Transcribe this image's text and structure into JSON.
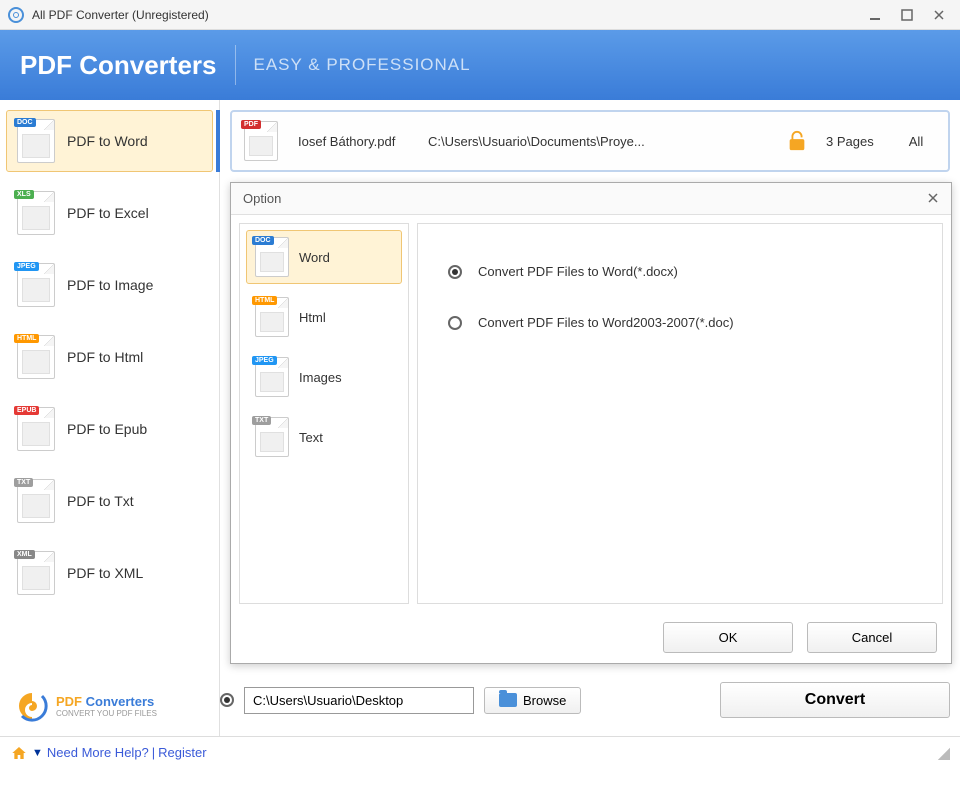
{
  "window": {
    "title": "All PDF Converter (Unregistered)"
  },
  "header": {
    "title": "PDF Converters",
    "tagline": "EASY & PROFESSIONAL"
  },
  "sidebar": {
    "items": [
      {
        "label": "PDF to Word",
        "badge": "DOC"
      },
      {
        "label": "PDF to Excel",
        "badge": "XLS"
      },
      {
        "label": "PDF to Image",
        "badge": "JPEG"
      },
      {
        "label": "PDF to Html",
        "badge": "HTML"
      },
      {
        "label": "PDF to Epub",
        "badge": "EPUB"
      },
      {
        "label": "PDF to Txt",
        "badge": "TXT"
      },
      {
        "label": "PDF to XML",
        "badge": "XML"
      }
    ]
  },
  "file": {
    "name": "Iosef Báthory.pdf",
    "path": "C:\\Users\\Usuario\\Documents\\Proye...",
    "pages": "3 Pages",
    "range": "All",
    "badge": "PDF"
  },
  "output": {
    "path": "C:\\Users\\Usuario\\Desktop",
    "browse_label": "Browse",
    "convert_label": "Convert"
  },
  "logo": {
    "pdf": "PDF",
    "conv": " Converters",
    "sub": "CONVERT YOU PDF FILES"
  },
  "modal": {
    "title": "Option",
    "tabs": [
      {
        "label": "Word",
        "badge": "DOC"
      },
      {
        "label": "Html",
        "badge": "HTML"
      },
      {
        "label": "Images",
        "badge": "JPEG"
      },
      {
        "label": "Text",
        "badge": "TXT"
      }
    ],
    "options": [
      {
        "label": "Convert PDF Files to Word(*.docx)",
        "selected": true
      },
      {
        "label": "Convert PDF Files to Word2003-2007(*.doc)",
        "selected": false
      }
    ],
    "ok_label": "OK",
    "cancel_label": "Cancel"
  },
  "footer": {
    "help": "Need More Help?",
    "register": "Register"
  }
}
